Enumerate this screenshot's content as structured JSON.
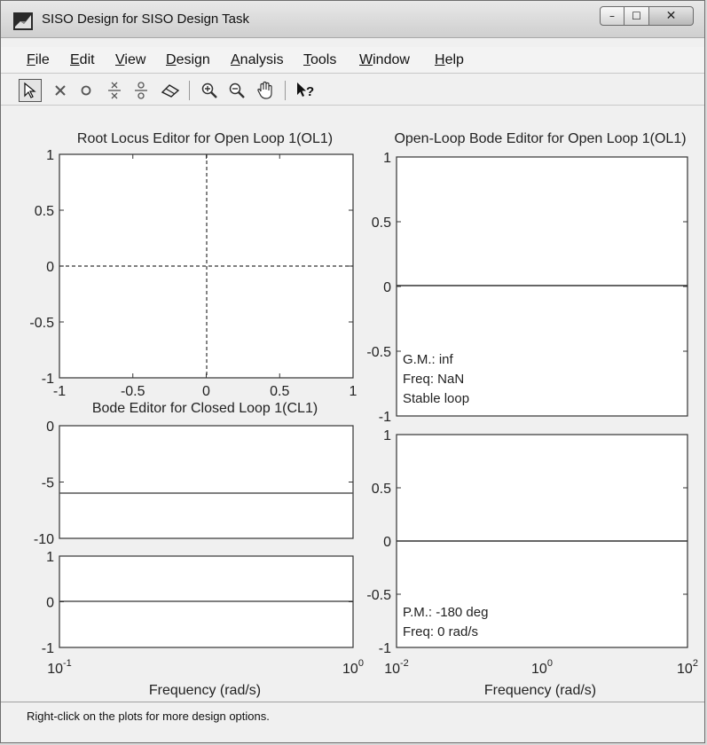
{
  "window": {
    "title": "SISO Design for SISO Design Task",
    "controls": {
      "minimize": "–",
      "maximize": "☐",
      "close": "✕"
    }
  },
  "menu": [
    "File",
    "Edit",
    "View",
    "Design",
    "Analysis",
    "Tools",
    "Window",
    "Help"
  ],
  "menu_underline": [
    "F",
    "E",
    "V",
    "D",
    "A",
    "T",
    "W",
    "H"
  ],
  "toolbar": {
    "tools": [
      "select-arrow-icon",
      "delete-x-icon",
      "pole-circle-icon",
      "add-pole-icon",
      "add-zero-icon",
      "eraser-icon",
      "zoom-in-icon",
      "zoom-out-icon",
      "pan-hand-icon",
      "whats-this-help-icon"
    ]
  },
  "plots": {
    "root_locus": {
      "title": "Root Locus Editor for Open Loop 1(OL1)",
      "yticks": [
        "1",
        "0.5",
        "0",
        "-0.5",
        "-1"
      ],
      "xticks": [
        "-1",
        "-0.5",
        "0",
        "0.5",
        "1"
      ]
    },
    "ol_bode": {
      "title": "Open-Loop Bode Editor for Open Loop 1(OL1)",
      "mag_yticks": [
        "1",
        "0.5",
        "0",
        "-0.5",
        "-1"
      ],
      "mag_annotation": [
        "G.M.: inf",
        "Freq: NaN",
        "Stable loop"
      ],
      "phase_yticks": [
        "1",
        "0.5",
        "0",
        "-0.5",
        "-1"
      ],
      "phase_annotation": [
        "P.M.: -180 deg",
        "Freq: 0 rad/s"
      ],
      "xticks": [
        {
          "base": "10",
          "exp": "-2"
        },
        {
          "base": "10",
          "exp": "0"
        },
        {
          "base": "10",
          "exp": "2"
        }
      ],
      "xlabel": "Frequency (rad/s)"
    },
    "cl_bode": {
      "title": "Bode Editor for Closed Loop 1(CL1)",
      "mag_yticks": [
        "0",
        "-5",
        "-10"
      ],
      "phase_yticks": [
        "1",
        "0",
        "-1"
      ],
      "xticks": [
        {
          "base": "10",
          "exp": "-1"
        },
        {
          "base": "10",
          "exp": "0"
        }
      ],
      "xlabel": "Frequency (rad/s)"
    }
  },
  "status": "Right-click on the plots for more design options."
}
